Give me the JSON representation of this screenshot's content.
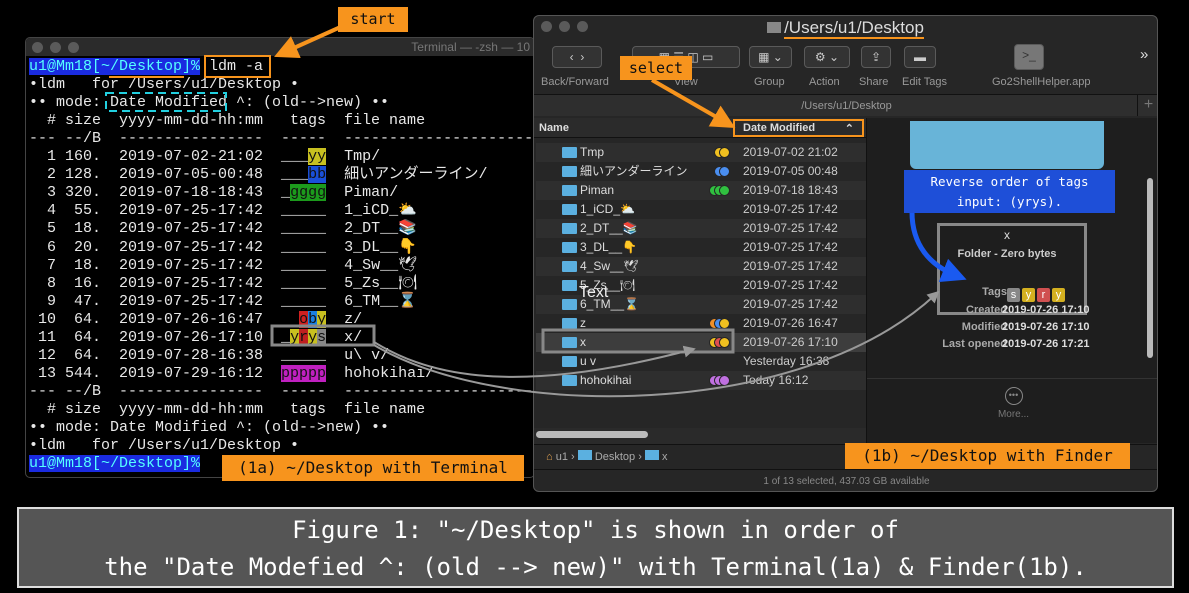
{
  "terminal": {
    "title": "Terminal — -zsh — 10",
    "prompt": "u1@Mm18[~/Desktop]%",
    "command": "ldm -a",
    "header_lines": [
      "•ldm   for /Users/u1/Desktop •",
      "•• mode: Date Modified ^: (old-->new) ••",
      "  # size  yyyy-mm-dd-hh:mm   tags  file name",
      "--- --/B  ----------------  -----  ----------------------"
    ],
    "rows": [
      {
        "n": "1",
        "size": "160.",
        "date": "2019-07-02-21:02",
        "tags": [
          {
            "t": "___",
            "c": ""
          },
          {
            "t": "yy",
            "c": "#c8c020"
          }
        ],
        "name": "Tmp/"
      },
      {
        "n": "2",
        "size": "128.",
        "date": "2019-07-05-00:48",
        "tags": [
          {
            "t": "___",
            "c": ""
          },
          {
            "t": "bb",
            "c": "#1a4fd8"
          }
        ],
        "name": "細いアンダーライン/"
      },
      {
        "n": "3",
        "size": "320.",
        "date": "2019-07-18-18:43",
        "tags": [
          {
            "t": "_",
            "c": ""
          },
          {
            "t": "gggg",
            "c": "#1c9a1c"
          }
        ],
        "name": "Piman/"
      },
      {
        "n": "4",
        "size": "55.",
        "date": "2019-07-25-17:42",
        "tags": [
          {
            "t": "_____",
            "c": ""
          }
        ],
        "name": "1_iCD_⛅"
      },
      {
        "n": "5",
        "size": "18.",
        "date": "2019-07-25-17:42",
        "tags": [
          {
            "t": "_____",
            "c": ""
          }
        ],
        "name": "2_DT__📚"
      },
      {
        "n": "6",
        "size": "20.",
        "date": "2019-07-25-17:42",
        "tags": [
          {
            "t": "_____",
            "c": ""
          }
        ],
        "name": "3_DL__👇"
      },
      {
        "n": "7",
        "size": "18.",
        "date": "2019-07-25-17:42",
        "tags": [
          {
            "t": "_____",
            "c": ""
          }
        ],
        "name": "4_Sw__🕊"
      },
      {
        "n": "8",
        "size": "16.",
        "date": "2019-07-25-17:42",
        "tags": [
          {
            "t": "_____",
            "c": ""
          }
        ],
        "name": "5_Zs__🍽"
      },
      {
        "n": "9",
        "size": "47.",
        "date": "2019-07-25-17:42",
        "tags": [
          {
            "t": "_____",
            "c": ""
          }
        ],
        "name": "6_TM__⌛"
      },
      {
        "n": "10",
        "size": "64.",
        "date": "2019-07-26-16:47",
        "tags": [
          {
            "t": "  ",
            "c": ""
          },
          {
            "t": "o",
            "c": "#d02020"
          },
          {
            "t": "b",
            "c": "#1a7fe0"
          },
          {
            "t": "y",
            "c": "#c8c020"
          }
        ],
        "name": "z/"
      },
      {
        "n": "11",
        "size": "64.",
        "date": "2019-07-26-17:10",
        "tags": [
          {
            "t": "_",
            "c": ""
          },
          {
            "t": "y",
            "c": "#c8c020"
          },
          {
            "t": "r",
            "c": "#c02020"
          },
          {
            "t": "y",
            "c": "#c8c020"
          },
          {
            "t": "s",
            "c": "#888"
          }
        ],
        "name": "x/"
      },
      {
        "n": "12",
        "size": "64.",
        "date": "2019-07-28-16:38",
        "tags": [
          {
            "t": "_____",
            "c": ""
          }
        ],
        "name": "u\\ v/"
      },
      {
        "n": "13",
        "size": "544.",
        "date": "2019-07-29-16:12",
        "tags": [
          {
            "t": "ppppp",
            "c": "#c020c0"
          }
        ],
        "name": "hohokihai/"
      }
    ],
    "footer_lines": [
      "--- --/B  ----------------  -----  ----------------------",
      "  # size  yyyy-mm-dd-hh:mm   tags  file name",
      "•• mode: Date Modified ^: (old-->new) ••",
      "•ldm   for /Users/u1/Desktop •"
    ]
  },
  "finder": {
    "title": "/Users/u1/Desktop",
    "toolbar": {
      "back_forward": "Back/Forward",
      "view": "View",
      "group": "Group",
      "action": "Action",
      "share": "Share",
      "edit_tags": "Edit Tags",
      "app": "Go2ShellHelper.app",
      "more": "»"
    },
    "path_bar": "/Users/u1/Desktop",
    "columns": {
      "name": "Name",
      "date": "Date Modified"
    },
    "rows": [
      {
        "name": "Tmp",
        "date": "2019-07-02 21:02",
        "dots": [
          "#f0c020",
          "#f0c020"
        ]
      },
      {
        "name": "細いアンダーライン",
        "date": "2019-07-05 00:48",
        "dots": [
          "#4a8ef0",
          "#4a8ef0"
        ]
      },
      {
        "name": "Piman",
        "date": "2019-07-18 18:43",
        "dots": [
          "#30c040",
          "#30c040",
          "#30c040"
        ]
      },
      {
        "name": "1_iCD_⛅",
        "date": "2019-07-25 17:42",
        "dots": []
      },
      {
        "name": "2_DT__📚",
        "date": "2019-07-25 17:42",
        "dots": []
      },
      {
        "name": "3_DL__👇",
        "date": "2019-07-25 17:42",
        "dots": []
      },
      {
        "name": "4_Sw__🕊",
        "date": "2019-07-25 17:42",
        "dots": []
      },
      {
        "name": "5_Zs__🍽",
        "date": "2019-07-25 17:42",
        "dots": []
      },
      {
        "name": "6_TM__⌛",
        "date": "2019-07-25 17:42",
        "dots": []
      },
      {
        "name": "z",
        "date": "2019-07-26 16:47",
        "dots": [
          "#f0902a",
          "#4a8ef0",
          "#f0c020"
        ]
      },
      {
        "name": "x",
        "date": "2019-07-26 17:10",
        "dots": [
          "#f0c020",
          "#e05050",
          "#f0c020"
        ]
      },
      {
        "name": "u v",
        "date": "Yesterday 16:38",
        "dots": []
      },
      {
        "name": "hohokihai",
        "date": "Today 16:12",
        "dots": [
          "#c070e0",
          "#c070e0",
          "#c070e0"
        ]
      }
    ],
    "overlay_text": "Text",
    "preview": {
      "name": "x",
      "kind": "Folder - Zero bytes",
      "tags_label": "Tags",
      "tags": [
        {
          "t": "s",
          "c": "#888"
        },
        {
          "t": "y",
          "c": "#d4b020"
        },
        {
          "t": "r",
          "c": "#d05050"
        },
        {
          "t": "y",
          "c": "#d4b020"
        }
      ],
      "created_label": "Created",
      "created": "2019-07-26 17:10",
      "modified_label": "Modified",
      "modified": "2019-07-26 17:10",
      "opened_label": "Last opened",
      "opened": "2019-07-26 17:21",
      "more": "More..."
    },
    "breadcrumb": [
      "u1",
      "Desktop",
      "x"
    ],
    "status": "1 of 13 selected, 437.03 GB available"
  },
  "annotations": {
    "start": "start",
    "select": "select",
    "reverse_note_1": "Reverse order of tags",
    "reverse_note_2": "input: (yrys).",
    "label_1a": "(1a) ~/Desktop with Terminal",
    "label_1b": "(1b) ~/Desktop with Finder"
  },
  "caption": {
    "line1": "Figure 1: \"~/Desktop\" is shown in order of",
    "line2": "the \"Date Modefied ^: (old --> new)\" with Terminal(1a) & Finder(1b)."
  }
}
